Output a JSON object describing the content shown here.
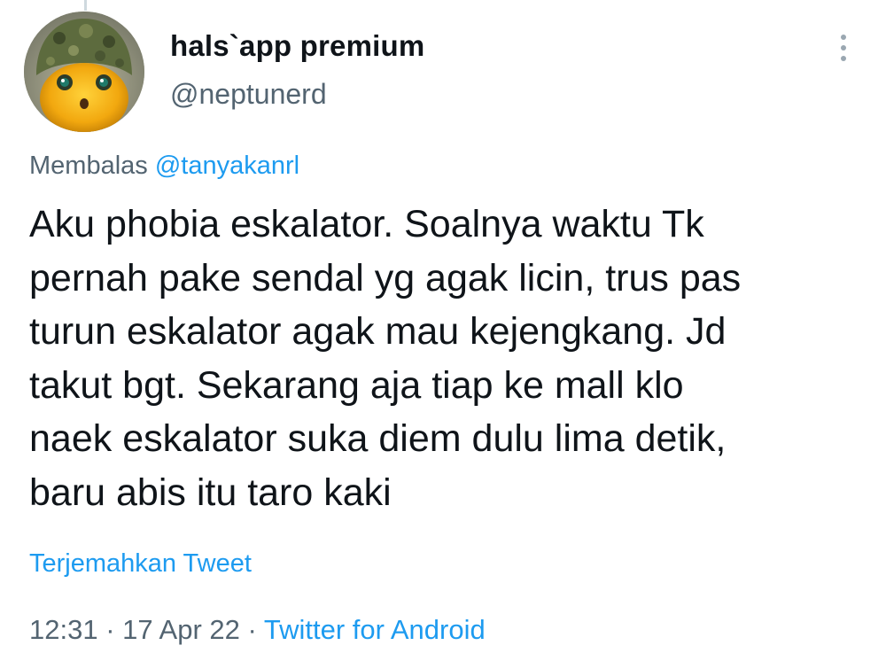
{
  "author": {
    "display_name": "hals`app premium",
    "handle": "@neptunerd",
    "avatar_icon": "helmet-character-avatar"
  },
  "more_menu_icon": "more-vertical-icon",
  "reply": {
    "prefix": "Membalas ",
    "to": "@tanyakanrl"
  },
  "tweet": {
    "text": "Aku phobia eskalator. Soalnya waktu Tk\npernah pake sendal yg agak licin, trus pas\nturun eskalator agak mau kejengkang. Jd\ntakut bgt. Sekarang aja tiap ke mall klo\nnaek eskalator suka diem dulu lima detik,\nbaru abis itu taro kaki"
  },
  "translate_label": "Terjemahkan Tweet",
  "meta": {
    "time": "12:31",
    "sep1": " · ",
    "date": "17 Apr 22",
    "sep2": " · ",
    "source": "Twitter for Android"
  },
  "colors": {
    "link": "#1d9bf0",
    "secondary_text": "#536471",
    "primary_text": "#0f1419",
    "background": "#ffffff"
  }
}
